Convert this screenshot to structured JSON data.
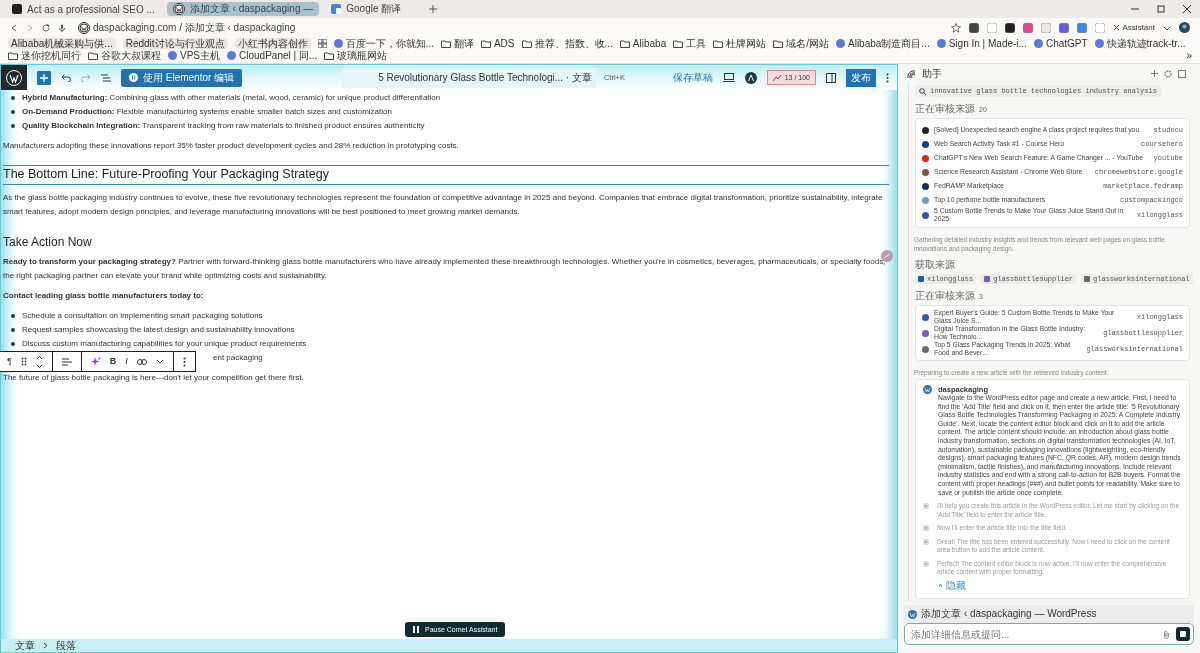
{
  "browser": {
    "tabs": [
      {
        "title": "Act as a professional SEO ...",
        "selected": false
      },
      {
        "title": "添加文章 ‹ daspackaging —",
        "selected": true
      },
      {
        "title": "Google 翻译",
        "selected": false
      }
    ],
    "address": "daspackaging.com / 添加文章 ‹ daspackaging",
    "assistant_button": "Assistant",
    "bookmarks": [
      {
        "label": "Alibaba机械采购与供...",
        "kind": "chip"
      },
      {
        "label": "Reddit讨论与行业观点",
        "kind": "chip"
      },
      {
        "label": "小红书内容创作",
        "kind": "chip"
      },
      {
        "label": "百度一下，你就知...",
        "kind": "site"
      },
      {
        "label": "翻译",
        "kind": "folder"
      },
      {
        "label": "ADS",
        "kind": "folder"
      },
      {
        "label": "推荐、指数、收...",
        "kind": "folder"
      },
      {
        "label": "Alibaba",
        "kind": "folder"
      },
      {
        "label": "工具",
        "kind": "folder"
      },
      {
        "label": "杜牌网站",
        "kind": "folder"
      },
      {
        "label": "域名/网站",
        "kind": "folder"
      },
      {
        "label": "Alibaba制造商目...",
        "kind": "site"
      },
      {
        "label": "Sign In | Made-i...",
        "kind": "site"
      },
      {
        "label": "ChatGPT",
        "kind": "site"
      },
      {
        "label": "快递轨迹track-tr...",
        "kind": "site"
      },
      {
        "label": "迷你挖机同行",
        "kind": "folder"
      },
      {
        "label": "谷歌大叔课程",
        "kind": "folder"
      },
      {
        "label": "VPS主机",
        "kind": "site"
      },
      {
        "label": "CloudPanel | 同...",
        "kind": "site"
      },
      {
        "label": "玻璃瓶网站",
        "kind": "folder"
      }
    ],
    "bookmarks_more": "»"
  },
  "editor": {
    "elementor_button": "使用 Elementor 编辑",
    "doc_title": "5 Revolutionary Glass Bottle Technologi... · 文章",
    "shortcut": "Ctrl+K",
    "save_draft": "保存草稿",
    "seo_score": "13 / 100",
    "publish": "发布",
    "blocks": [
      {
        "kind": "list",
        "selected": false,
        "items": [
          "**Hybrid Manufacturing:** Combining glass with other materials (metal, wood, ceramic) for unique product differentiation",
          "**On-Demand Production:** Flexible manufacturing systems enable smaller batch sizes and customization",
          "**Quality Blockchain Integration:** Transparent tracking from raw materials to finished product ensures authenticity"
        ]
      },
      {
        "kind": "paragraph",
        "selected": false,
        "text": "Manufacturers adopting these innovations report 35% faster product development cycles and 28% reduction in prototyping costs."
      },
      {
        "kind": "heading2",
        "selected": true,
        "text": "The Bottom Line: Future-Proofing Your Packaging Strategy"
      },
      {
        "kind": "paragraph",
        "selected": false,
        "text": "As the glass bottle packaging industry continues to evolve, these five revolutionary technologies represent the foundation of competitive advantage in 2025 and beyond. Companies that embrace digital transformation, prioritize sustainability, integrate smart features, adopt modern design principles, and leverage manufacturing innovations will be best positioned to meet growing market demands."
      },
      {
        "kind": "heading3",
        "selected": false,
        "text": "Take Action Now"
      },
      {
        "kind": "paragraph",
        "selected": false,
        "text": "**Ready to transform your packaging strategy?** Partner with forward-thinking glass bottle manufacturers who have already implemented these breakthrough technologies. Whether you're in cosmetics, beverages, pharmaceuticals, or specialty foods, the right packaging partner can elevate your brand while optimizing costs and sustainability."
      },
      {
        "kind": "paragraph",
        "selected": false,
        "text": "**Contact leading glass bottle manufacturers today to:**"
      },
      {
        "kind": "list",
        "selected": false,
        "items": [
          "Schedule a consultation on implementing smart packaging solutions",
          "Request samples showcasing the latest design and sustainability innovations",
          "Discuss custom manufacturing capabilities for your unique product requirements",
          "ent packaging"
        ]
      },
      {
        "kind": "paragraph",
        "selected": false,
        "text": "The future of glass bottle packaging is here—don't let your competition get there first."
      }
    ],
    "block_toolbar": {
      "paragraph": "¶",
      "bold": "B",
      "italic": "I"
    },
    "breadcrumb": [
      "文章",
      "段落"
    ],
    "pause_button": "Pause Comet Assistant"
  },
  "assistant": {
    "title": "助手",
    "query": "innovative glass bottle technologies industry analysis",
    "reviewing_label": "正在审核来源",
    "reviewing_count": "20",
    "sources": [
      {
        "title": "[Solved] Unexpected search engine A class project requires that you",
        "domain": "studocu",
        "color": "#222222"
      },
      {
        "title": "Web Search Activity Task #1 - Course Hero",
        "domain": "coursehero",
        "color": "#1b3a8c"
      },
      {
        "title": "ChatGPT's New Web Search Feature: A Game Changer ... - YouTube",
        "domain": "youtube",
        "color": "#e62117"
      },
      {
        "title": "Science Research Assistant - Chrome Web Store",
        "domain": "chromewebstore.google",
        "color": "#7a5a3a"
      },
      {
        "title": "FedRAMP Marketplace",
        "domain": "marketplace.fedramp",
        "color": "#1a2a5a"
      },
      {
        "title": "Top 10 perfume bottle manufacturers",
        "domain": "custompackingco",
        "color": "#6aa0d0"
      },
      {
        "title": "5 Custom Bottle Trends to Make Your Glass Juice Stand Out in 2025",
        "domain": "xilongglass",
        "color": "#2a5aa8"
      }
    ],
    "step_1": "Gathering detailed industry insights and trends from relevant web pages on glass bottle innovations and packaging design.",
    "fetched_label": "获取来源",
    "fetched": [
      {
        "domain": "xilongglass",
        "color": "#2a5aa8"
      },
      {
        "domain": "glassbottlesupplier",
        "color": "#7a5ac8"
      },
      {
        "domain": "glassworksinternational",
        "color": "#6a6a6a"
      }
    ],
    "reviewing_label_2": "正在审核来源",
    "reviewing_count_2": "3",
    "sources_2": [
      {
        "title": "Expert Buyer's Guide: 5 Custom Bottle Trends to Make Your Glass Juice S...",
        "domain": "xilongglass",
        "color": "#2a5aa8"
      },
      {
        "title": "Digital Transformation in the Glass Bottle Industry: How Technolo...",
        "domain": "glassbottlesupplier",
        "color": "#7a5ac8"
      },
      {
        "title": "Top 5 Glass Packaging Trends in 2025: What Food and Bever...",
        "domain": "glassworksinternational",
        "color": "#6a6a6a"
      }
    ],
    "step_2": "Preparing to create a new article with the retrieved industry content.",
    "task": {
      "site": "daspackaging",
      "text": "Navigate to the WordPress editor page and create a new article. First, I need to find the 'Add Title' field and click on it, then enter the article title: '5 Revolutionary Glass Bottle Technologies Transforming Packaging in 2025: A Complete Industry Guide'. Next, locate the content editor block and click on it to add the article content. The article content should include: an introduction about glass bottle industry transformation, sections on digital transformation technologies (AI, IoT, automation), sustainable packaging innovations (lightweighting, eco-friendly designs), smart packaging features (NFC, QR codes, AR), modern design trends (minimalism, tactile finishes), and manufacturing innovations. Include relevant industry statistics and end with a strong call-to-action for B2B buyers. Format the content with proper headings (###) and bullet points for readability. Make sure to save or publish the article once complete.",
      "steps": [
        "I'll help you create this article in the WordPress editor. Let me start by clicking on the 'Add Title' field to enter the article title.",
        "Now I'll enter the article title into the title field.",
        "Great! The title has been entered successfully. Now I need to click on the content area button to add the article content.",
        "Perfect! The content editor block is now active. I'll now enter the comprehensive article content with proper formatting."
      ],
      "hide": "隐藏"
    },
    "context": "添加文章 ‹ daspackaging — WordPress",
    "placeholder": "添加详细信息或提问..."
  }
}
